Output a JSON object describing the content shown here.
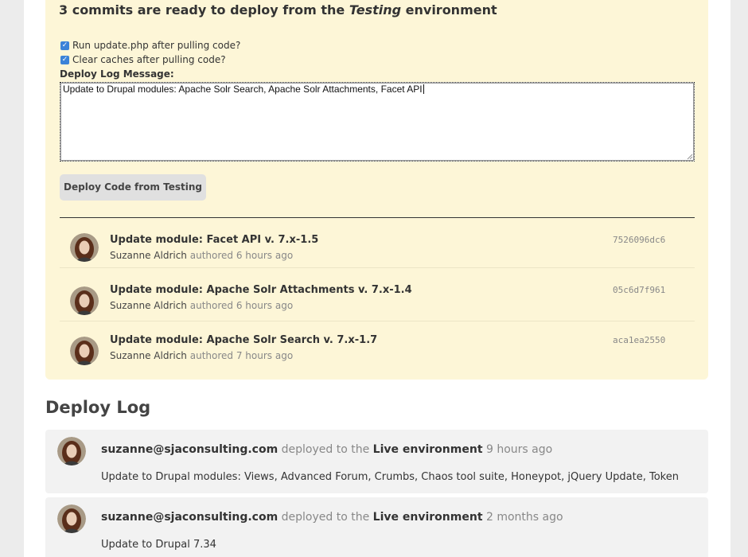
{
  "deploy": {
    "heading_pre": "3 commits are ready to deploy from the",
    "heading_env": "Testing",
    "heading_post": "environment",
    "options": [
      {
        "label": "Run update.php after pulling code?",
        "checked": true
      },
      {
        "label": "Clear caches after pulling code?",
        "checked": true
      }
    ],
    "message_label": "Deploy Log Message:",
    "message_value": "Update to Drupal modules: Apache Solr Search, Apache Solr Attachments, Facet API",
    "button_label": "Deploy Code from Testing"
  },
  "commits": [
    {
      "title": "Update module: Facet API v. 7.x-1.5",
      "author": "Suzanne Aldrich",
      "authored": "authored",
      "time": "6 hours ago",
      "hash": "7526096dc6"
    },
    {
      "title": "Update module: Apache Solr Attachments v. 7.x-1.4",
      "author": "Suzanne Aldrich",
      "authored": "authored",
      "time": "6 hours ago",
      "hash": "05c6d7f961"
    },
    {
      "title": "Update module: Apache Solr Search v. 7.x-1.7",
      "author": "Suzanne Aldrich",
      "authored": "authored",
      "time": "7 hours ago",
      "hash": "aca1ea2550"
    }
  ],
  "deploy_log": {
    "heading": "Deploy Log",
    "entries": [
      {
        "user": "suzanne@sjaconsulting.com",
        "action": "deployed to the",
        "target": "Live environment",
        "time": "9 hours ago",
        "message": "Update to Drupal modules: Views, Advanced Forum, Crumbs, Chaos tool suite, Honeypot, jQuery Update, Token"
      },
      {
        "user": "suzanne@sjaconsulting.com",
        "action": "deployed to the",
        "target": "Live environment",
        "time": "2 months ago",
        "message": "Update to Drupal 7.34"
      }
    ]
  },
  "colors": {
    "panel_bg": "#fdf6d7",
    "checkbox_accent": "#3b83d8",
    "log_entry_bg": "#f2f2f2",
    "page_bg": "#ececec"
  },
  "icons": {
    "checkbox": "check-icon",
    "avatar": "user-avatar",
    "textarea_resize": "resize-grip-icon"
  }
}
